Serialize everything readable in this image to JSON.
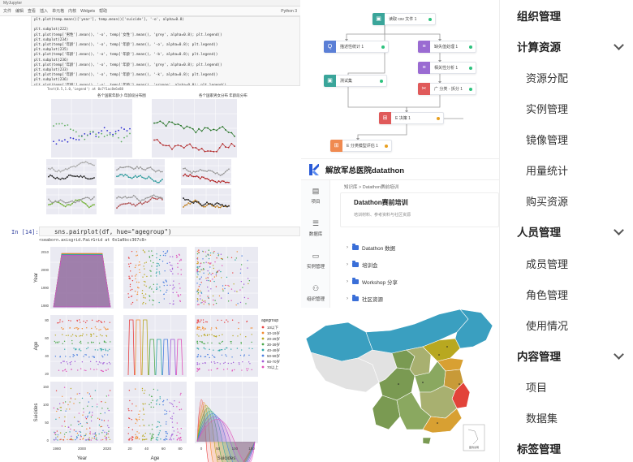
{
  "notebook": {
    "tab_title": "MyJupyter",
    "toolbar_items": [
      "文件",
      "编辑",
      "查看",
      "插入",
      "单元格",
      "内核",
      "Widgets",
      "帮助"
    ],
    "kernel": "Python 3",
    "code_lines": [
      "plt.plot(temp.mean()['year'], temp.mean()['suicide'], '-o', alpha=0.8)",
      "",
      "plt.subplot(222)",
      "plt.plot(temp['男性'].mean(), '-o', temp['女性'].mean(), 'grey', alpha=0.8); plt.legend()",
      "plt.subplot(234)",
      "plt.plot(temp['年龄'].mean(), '-o', temp['年龄'].mean(), '-o', alpha=0.8); plt.legend()",
      "plt.subplot(235)",
      "plt.plot(temp['年龄'].mean(), '-o', temp['年龄'].mean(), '-b', alpha=0.8); plt.legend()",
      "plt.subplot(236)",
      "plt.plot(temp['年龄'].mean(), '-o', temp['年龄'].mean(), 'grey', alpha=0.8); plt.legend()",
      "plt.subplot(233)",
      "plt.plot(temp['年龄'].mean(), '-o', temp['年龄'].mean(), '-k', alpha=0.8); plt.legend()",
      "plt.subplot(236)",
      "plt.plot(temp['年龄'].mean(), '-o', temp['年龄'].mean(), 'orange', alpha=0.8); plt.legend()"
    ],
    "warning": "Text(0.5,1.0,'Legend') at 0x7f1ac8e6e88",
    "plot1_title": "各个国家年龄小 年龄段分布图",
    "plot2_title": "各个国家男女分布 年龄段分布",
    "in_label": "In [14]:",
    "cell_code": "sns.pairplot(df, hue=\"agegroup\")",
    "cell_output": "<seaborn.axisgrid.PairGrid at 0x1a0bcc367c8>",
    "pair_ylabels": [
      "Year",
      "Age",
      "Suicides"
    ],
    "pair_xlabels": [
      "Year",
      "Age",
      "Suicides"
    ],
    "year_ticks": [
      "2010",
      "2000",
      "1990",
      "1980"
    ],
    "age_ticks": [
      "80",
      "60",
      "40",
      "20"
    ],
    "suicide_ticks": [
      "150",
      "100",
      "50",
      "0"
    ],
    "x_year_ticks": [
      "1980",
      "2000",
      "2020"
    ],
    "x_age_ticks": [
      "20",
      "40",
      "60",
      "80"
    ],
    "x_suicide_ticks": [
      "0",
      "50",
      "100",
      "150"
    ],
    "legend_title": "agegroup",
    "legend_items": [
      "10以下",
      "10-19岁",
      "20-29岁",
      "30-39岁",
      "40-49岁",
      "50-59岁",
      "60-70岁",
      "70以上"
    ],
    "legend_colors": [
      "#e84040",
      "#f28b30",
      "#b8a820",
      "#4aa84a",
      "#30a8a8",
      "#4a7fe0",
      "#a05ad8",
      "#e050b8"
    ]
  },
  "flow": {
    "nodes": [
      {
        "label": "读取 csv 文件 1",
        "color": "#3aa59a",
        "dot": "#2ec27e",
        "icon": "▣"
      },
      {
        "label": "描述性统计 1",
        "color": "#5b7fd6",
        "dot": "#2ec27e",
        "icon": "Q"
      },
      {
        "label": "缺失值处理 1",
        "color": "#9a6bd2",
        "dot": "#2ec27e",
        "icon": "≡"
      },
      {
        "label": "相关性分析 1",
        "color": "#9a6bd2",
        "dot": "#2ec27e",
        "icon": "≡"
      },
      {
        "label": "测试集",
        "color": "#3aa59a",
        "dot": "#2ec27e",
        "icon": "▣"
      },
      {
        "label": "广 分类 - 拆分 1",
        "color": "#e05a5a",
        "dot": "#2ec27e",
        "icon": "✂"
      },
      {
        "label": "E 决策 1",
        "color": "#e05a5a",
        "dot": "#e8a020",
        "icon": "⊞"
      },
      {
        "label": "E 分类模型评估 1",
        "color": "#f08a50",
        "dot": "#e8a020",
        "icon": "⊞"
      }
    ]
  },
  "datathon": {
    "title": "解放军总医院datathon",
    "nav": [
      {
        "label": "项目",
        "icon": "▤"
      },
      {
        "label": "数据库",
        "icon": "☰"
      },
      {
        "label": "实例管理",
        "icon": "▭"
      },
      {
        "label": "组织管理",
        "icon": "⚇"
      }
    ],
    "breadcrumb": "知识库 > Datathon赛前培训",
    "card_title": "Datathon赛前培训",
    "card_desc": "培训材料、参考资料与社区资源",
    "folders": [
      "Datathon 数据",
      "培训会",
      "Workshop 分享",
      "社区资源"
    ]
  },
  "map": {
    "legend": "图例说明",
    "colors": {
      "sea": "#3a9fc0",
      "high": "#e2433a",
      "mid": "#d8a032",
      "low": "#7a9a52",
      "gray": "#e2e2e2"
    }
  },
  "menu": {
    "items": [
      {
        "label": "组织管理",
        "level": "top",
        "chevron": false
      },
      {
        "label": "计算资源",
        "level": "top",
        "chevron": true
      },
      {
        "label": "资源分配",
        "level": "sub"
      },
      {
        "label": "实例管理",
        "level": "sub"
      },
      {
        "label": "镜像管理",
        "level": "sub"
      },
      {
        "label": "用量统计",
        "level": "sub"
      },
      {
        "label": "购买资源",
        "level": "sub"
      },
      {
        "label": "人员管理",
        "level": "top",
        "chevron": true
      },
      {
        "label": "成员管理",
        "level": "sub"
      },
      {
        "label": "角色管理",
        "level": "sub"
      },
      {
        "label": "使用情况",
        "level": "sub"
      },
      {
        "label": "内容管理",
        "level": "top",
        "chevron": true
      },
      {
        "label": "项目",
        "level": "sub"
      },
      {
        "label": "数据集",
        "level": "sub"
      },
      {
        "label": "标签管理",
        "level": "top",
        "chevron": false
      }
    ]
  }
}
